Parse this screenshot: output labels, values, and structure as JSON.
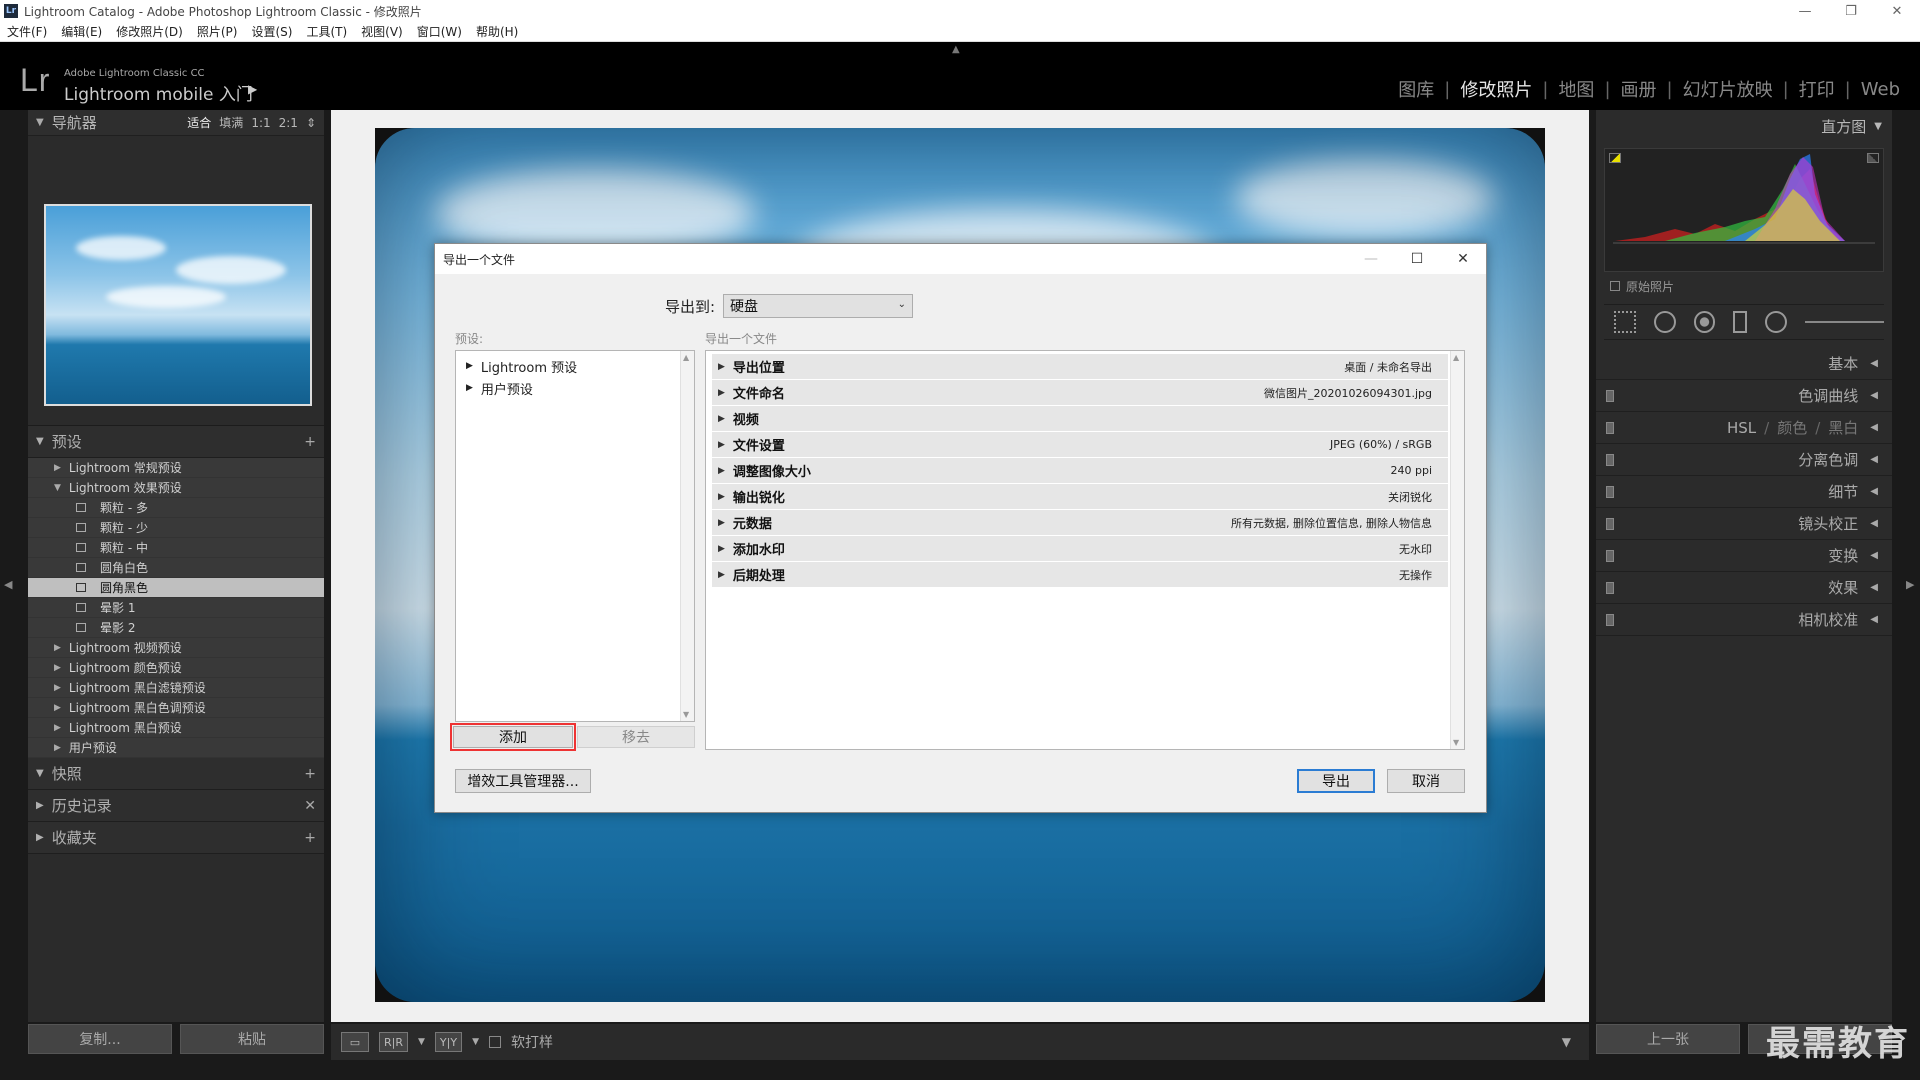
{
  "window": {
    "title": "Lightroom Catalog - Adobe Photoshop Lightroom Classic - 修改照片",
    "app_icon": "Lr",
    "controls": [
      "—",
      "❐",
      "✕"
    ]
  },
  "menu": [
    "文件(F)",
    "编辑(E)",
    "修改照片(D)",
    "照片(P)",
    "设置(S)",
    "工具(T)",
    "视图(V)",
    "窗口(W)",
    "帮助(H)"
  ],
  "identity": {
    "logo": "Lr",
    "brand_small": "Adobe Lightroom Classic CC",
    "brand_main": "Lightroom mobile 入门",
    "modules": [
      "图库",
      "修改照片",
      "地图",
      "画册",
      "幻灯片放映",
      "打印",
      "Web"
    ],
    "active_module": "修改照片"
  },
  "left": {
    "navigator": {
      "title": "导航器",
      "zoom": [
        "适合",
        "填满",
        "1:1",
        "2:1"
      ]
    },
    "presets": {
      "title": "预设",
      "items": [
        {
          "label": "Lightroom 常规预设",
          "type": "folder",
          "open": false
        },
        {
          "label": "Lightroom 效果预设",
          "type": "folder",
          "open": true
        },
        {
          "label": "颗粒 - 多",
          "type": "child"
        },
        {
          "label": "颗粒 - 少",
          "type": "child"
        },
        {
          "label": "颗粒 - 中",
          "type": "child"
        },
        {
          "label": "圆角白色",
          "type": "child"
        },
        {
          "label": "圆角黑色",
          "type": "child",
          "selected": true
        },
        {
          "label": "晕影 1",
          "type": "child"
        },
        {
          "label": "晕影 2",
          "type": "child"
        },
        {
          "label": "Lightroom 视频预设",
          "type": "folder",
          "open": false
        },
        {
          "label": "Lightroom 颜色预设",
          "type": "folder",
          "open": false
        },
        {
          "label": "Lightroom 黑白滤镜预设",
          "type": "folder",
          "open": false
        },
        {
          "label": "Lightroom 黑白色调预设",
          "type": "folder",
          "open": false
        },
        {
          "label": "Lightroom 黑白预设",
          "type": "folder",
          "open": false
        },
        {
          "label": "用户预设",
          "type": "folder",
          "open": false
        }
      ]
    },
    "snapshots": "快照",
    "history": "历史记录",
    "collections": "收藏夹",
    "copy_button": "复制...",
    "paste_button": "粘贴"
  },
  "toolbar": {
    "soft_proof": "软打样",
    "before_after_1": "R|R",
    "before_after_2": "Y|Y"
  },
  "right": {
    "histogram": "直方图",
    "original_photo": "原始照片",
    "panels": [
      "基本",
      "色调曲线",
      "细节",
      "镜头校正",
      "变换",
      "效果",
      "相机校准"
    ],
    "hsl": [
      "HSL",
      "颜色",
      "黑白"
    ],
    "split_toning": "分离色调",
    "prev_button": "上一张"
  },
  "watermark": "最需教育",
  "dialog": {
    "title": "导出一个文件",
    "export_to_label": "导出到:",
    "export_to_value": "硬盘",
    "presets_label": "预设:",
    "settings_label": "导出一个文件",
    "preset_items": [
      "Lightroom 预设",
      "用户预设"
    ],
    "add_button": "添加",
    "remove_button": "移去",
    "plugin_button": "增效工具管理器...",
    "export_button": "导出",
    "cancel_button": "取消",
    "sections": [
      {
        "name": "导出位置",
        "value": "桌面 / 未命名导出"
      },
      {
        "name": "文件命名",
        "value": "微信图片_20201026094301.jpg"
      },
      {
        "name": "视频",
        "value": ""
      },
      {
        "name": "文件设置",
        "value": "JPEG (60%) / sRGB"
      },
      {
        "name": "调整图像大小",
        "value": "240 ppi"
      },
      {
        "name": "输出锐化",
        "value": "关闭锐化"
      },
      {
        "name": "元数据",
        "value": "所有元数据, 删除位置信息, 删除人物信息"
      },
      {
        "name": "添加水印",
        "value": "无水印"
      },
      {
        "name": "后期处理",
        "value": "无操作"
      }
    ]
  },
  "colors": {
    "accent_blue": "#2b7cd3",
    "highlight_red": "#e33333",
    "panel_bg": "#2b2b2b"
  }
}
